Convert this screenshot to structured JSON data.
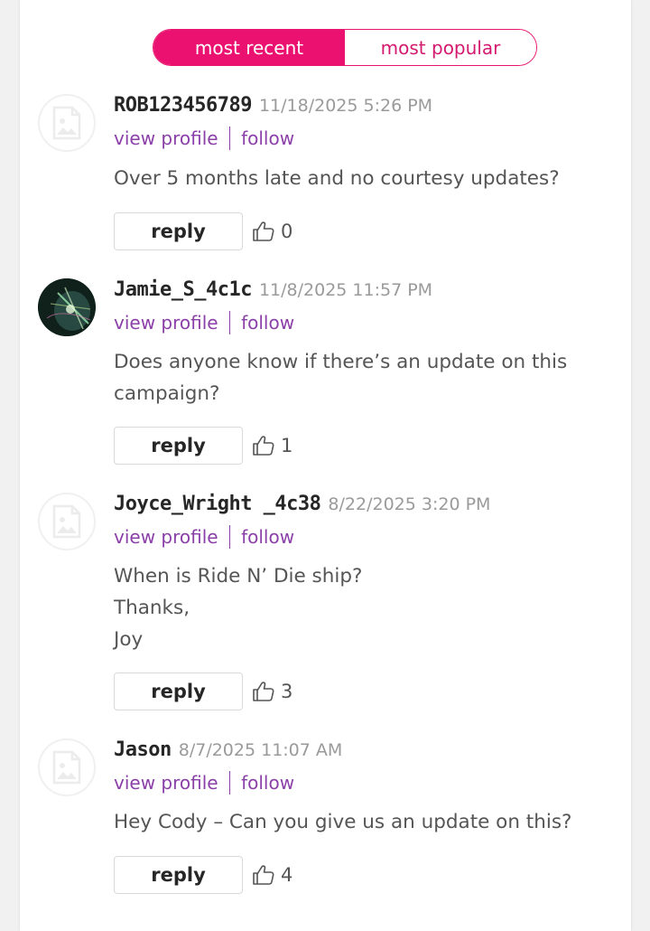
{
  "sort": {
    "most_recent": "most recent",
    "most_popular": "most popular"
  },
  "comments": [
    {
      "username": "ROB123456789",
      "timestamp": "11/18/2025 5:26 PM",
      "view_profile": "view profile",
      "follow": "follow",
      "body": "Over 5 months late and no courtesy updates?",
      "reply": "reply",
      "likes": "0",
      "avatar": "placeholder-image-icon"
    },
    {
      "username": "Jamie_S_4c1c",
      "timestamp": "11/8/2025 11:57 PM",
      "view_profile": "view profile",
      "follow": "follow",
      "body": "Does anyone know if there’s an update on this campaign?",
      "reply": "reply",
      "likes": "1",
      "avatar": "user-photo"
    },
    {
      "username": "Joyce_Wright _4c38",
      "timestamp": "8/22/2025 3:20 PM",
      "view_profile": "view profile",
      "follow": "follow",
      "body_lines": [
        "When is Ride N’ Die ship?",
        "Thanks,",
        "Joy"
      ],
      "reply": "reply",
      "likes": "3",
      "avatar": "placeholder-image-icon"
    },
    {
      "username": "Jason",
      "timestamp": "8/7/2025 11:07 AM",
      "view_profile": "view profile",
      "follow": "follow",
      "body": "Hey Cody – Can you give us an update on this?",
      "reply": "reply",
      "likes": "4",
      "avatar": "placeholder-image-icon"
    }
  ],
  "colors": {
    "accent": "#ea1170",
    "link": "#8b3fa8",
    "text": "#555555",
    "muted": "#9a9a9a"
  }
}
